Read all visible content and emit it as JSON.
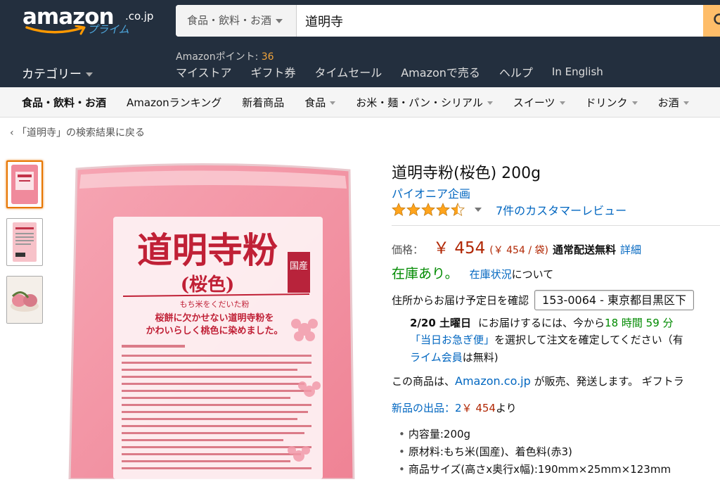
{
  "header": {
    "logo_word": "amazon",
    "logo_tld": ".co.jp",
    "logo_prime": "プライム",
    "search_category": "食品・飲料・お酒",
    "search_query": "道明寺",
    "points_label": "Amazonポイント: ",
    "points_value": "36",
    "category_menu": "カテゴリー",
    "nav_links": [
      "マイストア",
      "ギフト券",
      "タイムセール",
      "Amazonで売る",
      "ヘルプ",
      "In English"
    ]
  },
  "subnav": [
    "食品・飲料・お酒",
    "Amazonランキング",
    "新着商品",
    "食品",
    "お米・麺・パン・シリアル",
    "スイーツ",
    "ドリンク",
    "お酒"
  ],
  "breadcrumb": "‹ 「道明寺」の検索結果に戻る",
  "product": {
    "title": "道明寺粉(桜色) 200g",
    "brand": "パイオニア企画",
    "rating": 4.5,
    "reviews_link": "7件のカスタマーレビュー",
    "price_label": "価格：",
    "price": "￥ 454",
    "unit_price": "(￥ 454 / 袋)",
    "shipping": "通常配送無料",
    "details_link": "詳細",
    "stock": "在庫あり。",
    "stock_link": "在庫状況",
    "stock_after": "について",
    "delivery_label": "住所からお届け予定日を確認",
    "zip": "153-0064 - 東京都目黒区下",
    "eta_date": "2/20 土曜日",
    "eta_text": "にお届けするには、今から",
    "eta_time": "18 時間 59 分",
    "express_link": "「当日お急ぎ便」",
    "express_text": "を選択して注文を確定してください（有",
    "prime_link": "ライム会員",
    "prime_text": "は無料)",
    "seller_pre": "この商品は、",
    "seller_link": "Amazon.co.jp",
    "seller_post": " が販売、発送します。 ギフトラ",
    "new_offers_link": "新品の出品：2",
    "new_offers_price": "￥ 454",
    "new_offers_after": "より",
    "bullets": [
      "内容量:200g",
      "原材料:もち米(国産)、着色料(赤3)",
      "商品サイズ(高さx奥行x幅):190mm×25mm×123mm"
    ]
  },
  "package": {
    "name": "道明寺粉",
    "variant": "(桜色)",
    "origin": "国産",
    "tagline": "もち米をくだいた粉",
    "desc1": "桜餅に欠かせない道明寺粉を",
    "desc2": "かわいらしく桃色に染めました。"
  },
  "colors": {
    "header_bg": "#232f3e",
    "link": "#0066c0",
    "price": "#b12704",
    "in_stock": "#008a00",
    "star": "#ffa41c",
    "search_button": "#febd69"
  }
}
